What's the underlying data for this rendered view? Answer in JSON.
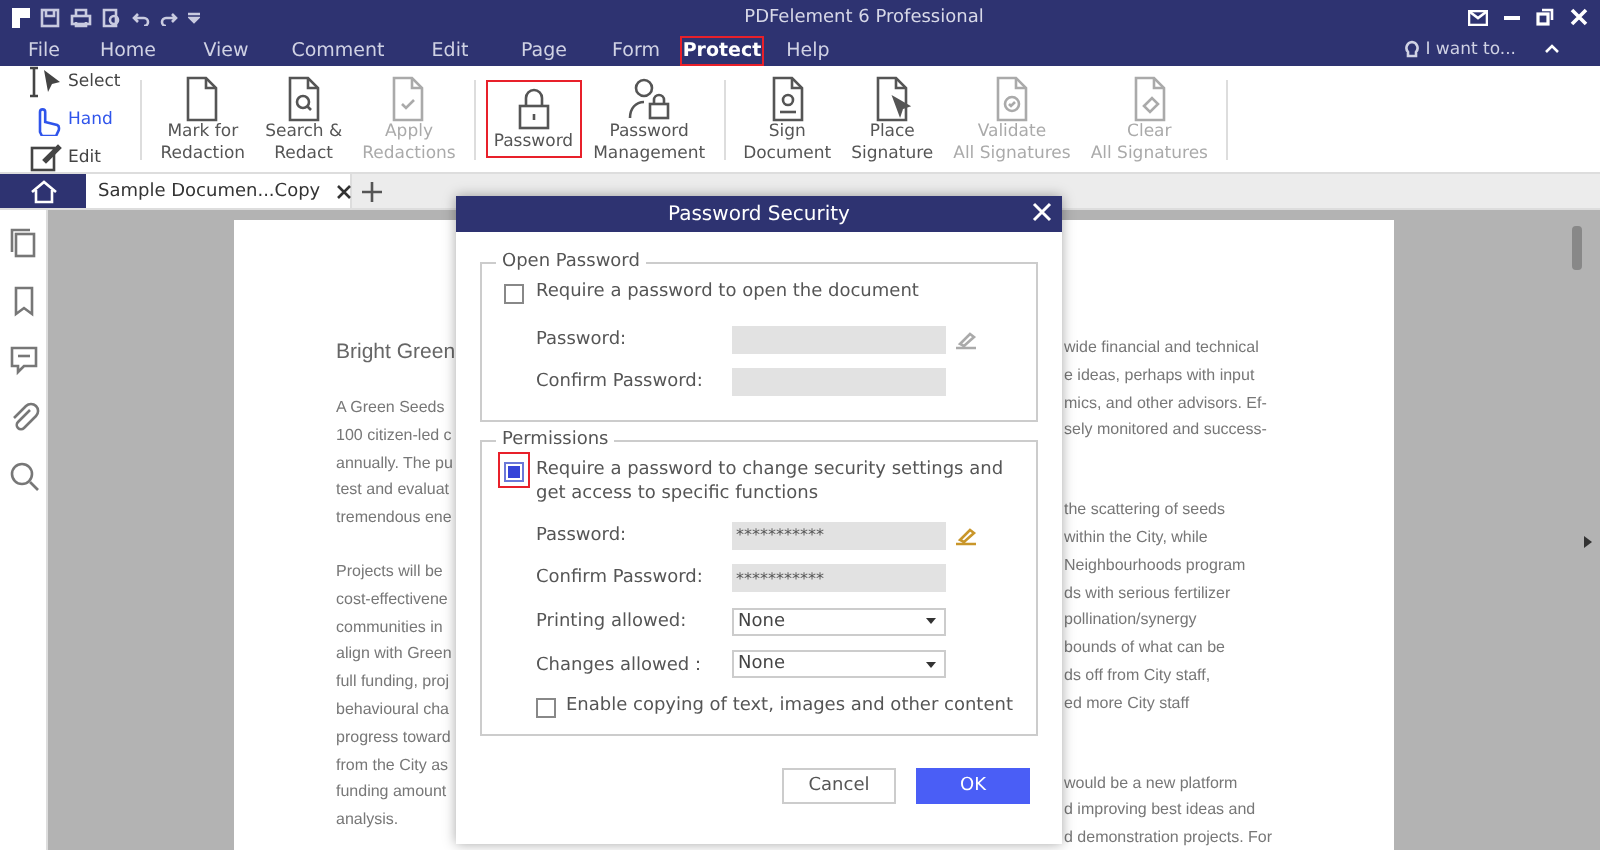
{
  "window": {
    "title": "PDFelement 6 Professional"
  },
  "menu": [
    {
      "label": "File",
      "selected": false,
      "highlighted": false
    },
    {
      "label": "Home",
      "selected": false,
      "highlighted": false
    },
    {
      "label": "View",
      "selected": false,
      "highlighted": false
    },
    {
      "label": "Comment",
      "selected": false,
      "highlighted": false
    },
    {
      "label": "Edit",
      "selected": false,
      "highlighted": false
    },
    {
      "label": "Page",
      "selected": false,
      "highlighted": false
    },
    {
      "label": "Form",
      "selected": false,
      "highlighted": false
    },
    {
      "label": "Protect",
      "selected": true,
      "highlighted": true
    },
    {
      "label": "Help",
      "selected": false,
      "highlighted": false
    }
  ],
  "search": {
    "placeholder": "I want to..."
  },
  "ribbon": {
    "tools": [
      {
        "label": "Select",
        "selected": false
      },
      {
        "label": "Hand",
        "selected": true
      },
      {
        "label": "Edit",
        "selected": false
      }
    ],
    "groups": [
      [
        {
          "label": "Mark for\nRedaction",
          "disabled": false,
          "highlighted": false
        },
        {
          "label": "Search &\nRedact",
          "disabled": false,
          "highlighted": false
        },
        {
          "label": "Apply\nRedactions",
          "disabled": true,
          "highlighted": false
        }
      ],
      [
        {
          "label": "Password",
          "disabled": false,
          "highlighted": true
        },
        {
          "label": "Password\nManagement",
          "disabled": false,
          "highlighted": false
        }
      ],
      [
        {
          "label": "Sign\nDocument",
          "disabled": false,
          "highlighted": false
        },
        {
          "label": "Place\nSignature",
          "disabled": false,
          "highlighted": false
        },
        {
          "label": "Validate\nAll Signatures",
          "disabled": true,
          "highlighted": false
        },
        {
          "label": "Clear\nAll Signatures",
          "disabled": true,
          "highlighted": false
        }
      ]
    ]
  },
  "tabs": [
    {
      "label": "Sample Documen...Copy",
      "selected": true
    }
  ],
  "document": {
    "heading": "Bright Green",
    "left_paragraphs": [
      [
        "A Green Seeds",
        "100 citizen-led c",
        "annually. The pu",
        "test and evaluat",
        "tremendous ene"
      ],
      [
        "Projects will be",
        "cost-effectivene",
        "communities in",
        "align with Green",
        "full funding, proj",
        "behavioural cha",
        "progress toward",
        "from the City as",
        "funding amount",
        "analysis."
      ]
    ],
    "right_paragraphs": [
      [
        "wide financial and technical",
        "e ideas, perhaps with input",
        "mics, and other advisors. Ef-",
        "sely monitored and success-"
      ],
      [
        "the scattering of seeds",
        "within the City, while",
        "Neighbourhoods program",
        "ds with serious fertilizer",
        "pollination/synergy",
        "bounds of what can be",
        "ds off from City staff,",
        "ed more City staff"
      ],
      [
        "would be a new platform",
        "d improving best ideas and",
        "d demonstration projects. For"
      ]
    ]
  },
  "dialog": {
    "title": "Password Security",
    "sections": [
      {
        "legend": "Open Password",
        "require": {
          "label": "Require a password to open the document",
          "checked": false,
          "highlighted": false
        },
        "fields": [
          {
            "label": "Password:",
            "kind": "password",
            "edit_icon": true
          },
          {
            "label": "Confirm Password:",
            "kind": "password",
            "edit_icon": false
          }
        ]
      },
      {
        "legend": "Permissions",
        "require": {
          "label": "Require a password to change security settings and get access to specific functions",
          "checked": true,
          "highlighted": true
        },
        "fields": [
          {
            "label": "Password:",
            "kind": "password",
            "value": "***********",
            "edit_icon": true
          },
          {
            "label": "Confirm Password:",
            "kind": "password",
            "value": "***********",
            "edit_icon": false
          },
          {
            "label": "Printing allowed:",
            "kind": "select",
            "value": "None",
            "edit_icon": false
          },
          {
            "label": "Changes allowed：",
            "kind": "select",
            "value": "None",
            "edit_icon": false
          }
        ],
        "option": {
          "label": "Enable copying of text, images and other content",
          "checked": false
        }
      }
    ],
    "buttons": [
      {
        "label": "Cancel",
        "kind": "secondary"
      },
      {
        "label": "OK",
        "kind": "primary"
      }
    ]
  }
}
